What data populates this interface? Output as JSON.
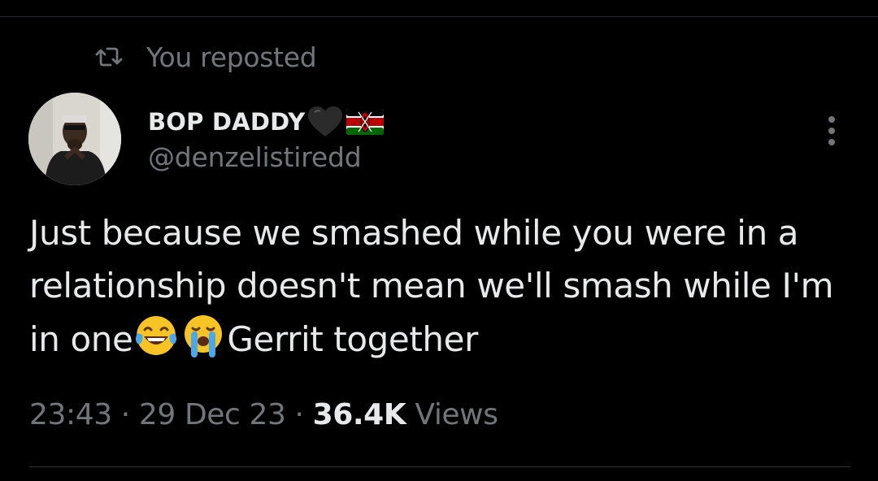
{
  "repost": {
    "label": "You reposted",
    "icon": "repost-icon"
  },
  "author": {
    "display_name": "BOP DADDY",
    "name_emojis": [
      "black-heart-icon",
      "kenya-flag-icon"
    ],
    "handle": "@denzelistiredd",
    "avatar": "avatar"
  },
  "tweet": {
    "text_part1": "Just because we smashed while you were in a relationship doesn't mean we'll smash while I'm in one",
    "emojis": [
      "tears-of-joy-emoji",
      "loudly-crying-emoji"
    ],
    "text_part2": "Gerrit together"
  },
  "meta": {
    "time": "23:43",
    "separator": " · ",
    "date": "29 Dec 23",
    "views_count": "36.4K",
    "views_label": " Views"
  },
  "colors": {
    "background": "#000000",
    "primary_text": "#e7e9ea",
    "secondary_text": "#71767b",
    "divider": "#2f3336"
  }
}
